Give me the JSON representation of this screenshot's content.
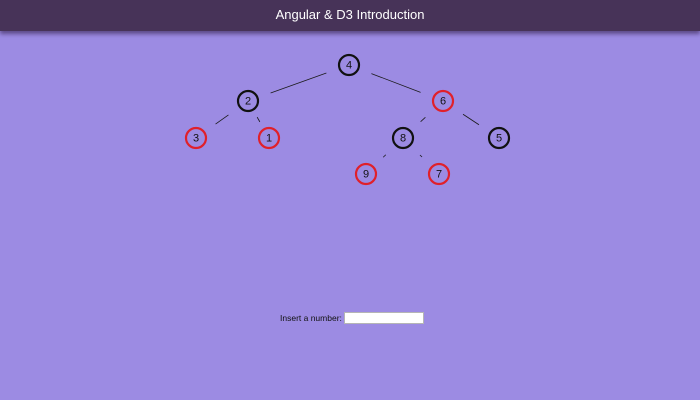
{
  "header": {
    "title": "Angular & D3 Introduction"
  },
  "colors": {
    "background": "#9c8be3",
    "header": "#473358",
    "black_node": "#111111",
    "red_node": "#e0202a"
  },
  "tree": {
    "nodes": [
      {
        "id": "n4",
        "label": "4",
        "color": "black"
      },
      {
        "id": "n2",
        "label": "2",
        "color": "black"
      },
      {
        "id": "n6",
        "label": "6",
        "color": "red"
      },
      {
        "id": "n3",
        "label": "3",
        "color": "red"
      },
      {
        "id": "n1",
        "label": "1",
        "color": "red"
      },
      {
        "id": "n8",
        "label": "8",
        "color": "black"
      },
      {
        "id": "n5",
        "label": "5",
        "color": "black"
      },
      {
        "id": "n9",
        "label": "9",
        "color": "red"
      },
      {
        "id": "n7",
        "label": "7",
        "color": "red"
      }
    ],
    "edges": [
      [
        "n4",
        "n2"
      ],
      [
        "n4",
        "n6"
      ],
      [
        "n2",
        "n3"
      ],
      [
        "n2",
        "n1"
      ],
      [
        "n6",
        "n8"
      ],
      [
        "n6",
        "n5"
      ],
      [
        "n8",
        "n9"
      ],
      [
        "n8",
        "n7"
      ]
    ]
  },
  "form": {
    "label": "Insert a number:",
    "value": "",
    "placeholder": ""
  }
}
